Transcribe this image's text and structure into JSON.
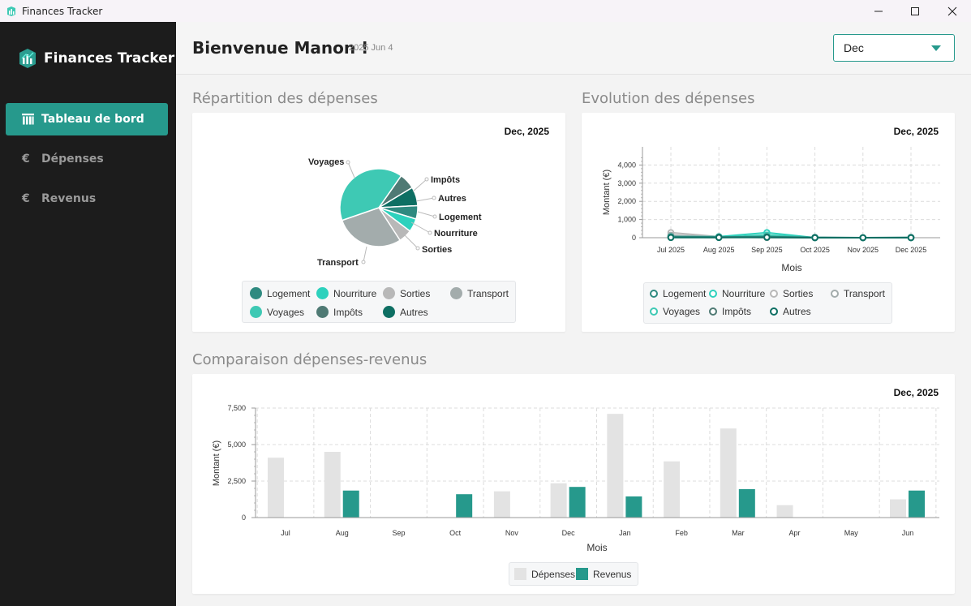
{
  "window": {
    "title": "Finances Tracker"
  },
  "sidebar": {
    "brand": "Finances Tracker",
    "items": [
      {
        "label": "Tableau de bord",
        "icon": "chart-icon",
        "active": true
      },
      {
        "label": "Dépenses",
        "icon": "euro-icon",
        "symbol": "€",
        "active": false
      },
      {
        "label": "Revenus",
        "icon": "euro-icon",
        "symbol": "€",
        "active": false
      }
    ]
  },
  "header": {
    "welcome": "Bienvenue Manon !",
    "date": "2025 Jun 4",
    "month_select": {
      "value": "Dec"
    }
  },
  "colors": {
    "accent": "#26998c",
    "sidebar_bg": "#1c1c1c",
    "expenses_bar": "#e3e3e3",
    "revenue_bar": "#26998c"
  },
  "sections": {
    "pie_title": "Répartition des dépenses",
    "line_title": "Evolution des dépenses",
    "bar_title": "Comparaison dépenses-revenus"
  },
  "chart_data": [
    {
      "type": "pie",
      "date_label": "Dec, 2025",
      "slices": [
        {
          "label": "Voyages",
          "value": 36,
          "color": "#3ec9b4"
        },
        {
          "label": "Transport",
          "value": 26,
          "color": "#a3acac"
        },
        {
          "label": "Sorties",
          "value": 5,
          "color": "#b8b8b8"
        },
        {
          "label": "Nourriture",
          "value": 5,
          "color": "#2dd1bd"
        },
        {
          "label": "Logement",
          "value": 5,
          "color": "#2f8a80"
        },
        {
          "label": "Autres",
          "value": 7,
          "color": "#0e6f63"
        },
        {
          "label": "Impôts",
          "value": 6,
          "color": "#4f7a74"
        }
      ],
      "legend": [
        {
          "label": "Logement",
          "color": "#2f8a80"
        },
        {
          "label": "Nourriture",
          "color": "#2dd1bd"
        },
        {
          "label": "Sorties",
          "color": "#b8b8b8"
        },
        {
          "label": "Transport",
          "color": "#a3acac"
        },
        {
          "label": "Voyages",
          "color": "#3ec9b4"
        },
        {
          "label": "Impôts",
          "color": "#4f7a74"
        },
        {
          "label": "Autres",
          "color": "#0e6f63"
        }
      ],
      "legend_placement": "bottom"
    },
    {
      "type": "line",
      "date_label": "Dec, 2025",
      "x": [
        "Jul 2025",
        "Aug 2025",
        "Sep 2025",
        "Oct 2025",
        "Nov 2025",
        "Dec 2025"
      ],
      "xlabel": "Mois",
      "ylabel": "Montant (€)",
      "ylim": [
        0,
        5000
      ],
      "yticks": [
        "0",
        "1,000",
        "2,000",
        "3,000",
        "4,000"
      ],
      "ytick_values": [
        0,
        1000,
        2000,
        3000,
        4000
      ],
      "grid": true,
      "series": [
        {
          "name": "Logement",
          "color": "#2f8a80",
          "values": [
            50,
            40,
            60,
            20,
            0,
            20
          ]
        },
        {
          "name": "Nourriture",
          "color": "#2dd1bd",
          "values": [
            60,
            60,
            280,
            0,
            0,
            0
          ]
        },
        {
          "name": "Sorties",
          "color": "#b8b8b8",
          "values": [
            280,
            60,
            0,
            0,
            0,
            0
          ]
        },
        {
          "name": "Transport",
          "color": "#a3acac",
          "values": [
            140,
            40,
            80,
            0,
            0,
            0
          ]
        },
        {
          "name": "Voyages",
          "color": "#3ec9b4",
          "values": [
            20,
            20,
            150,
            0,
            0,
            0
          ]
        },
        {
          "name": "Impôts",
          "color": "#4f7a74",
          "values": [
            30,
            20,
            40,
            0,
            0,
            0
          ]
        },
        {
          "name": "Autres",
          "color": "#0e6f63",
          "values": [
            10,
            10,
            20,
            0,
            0,
            0
          ]
        }
      ],
      "legend_placement": "bottom"
    },
    {
      "type": "bar",
      "date_label": "Dec, 2025",
      "categories": [
        "Jul",
        "Aug",
        "Sep",
        "Oct",
        "Nov",
        "Dec",
        "Jan",
        "Feb",
        "Mar",
        "Apr",
        "May",
        "Jun"
      ],
      "xlabel": "Mois",
      "ylabel": "Montant (€)",
      "ylim": [
        0,
        7500
      ],
      "yticks": [
        "0",
        "2,500",
        "5,000",
        "7,500"
      ],
      "ytick_values": [
        0,
        2500,
        5000,
        7500
      ],
      "grid": true,
      "series": [
        {
          "name": "Dépenses",
          "color": "#e3e3e3",
          "values": [
            4100,
            4500,
            0,
            0,
            1800,
            2350,
            7100,
            3850,
            6100,
            850,
            0,
            1250
          ]
        },
        {
          "name": "Revenus",
          "color": "#26998c",
          "values": [
            0,
            1850,
            0,
            1600,
            0,
            2100,
            1450,
            0,
            1950,
            0,
            0,
            1850
          ]
        }
      ],
      "legend_placement": "bottom"
    }
  ]
}
